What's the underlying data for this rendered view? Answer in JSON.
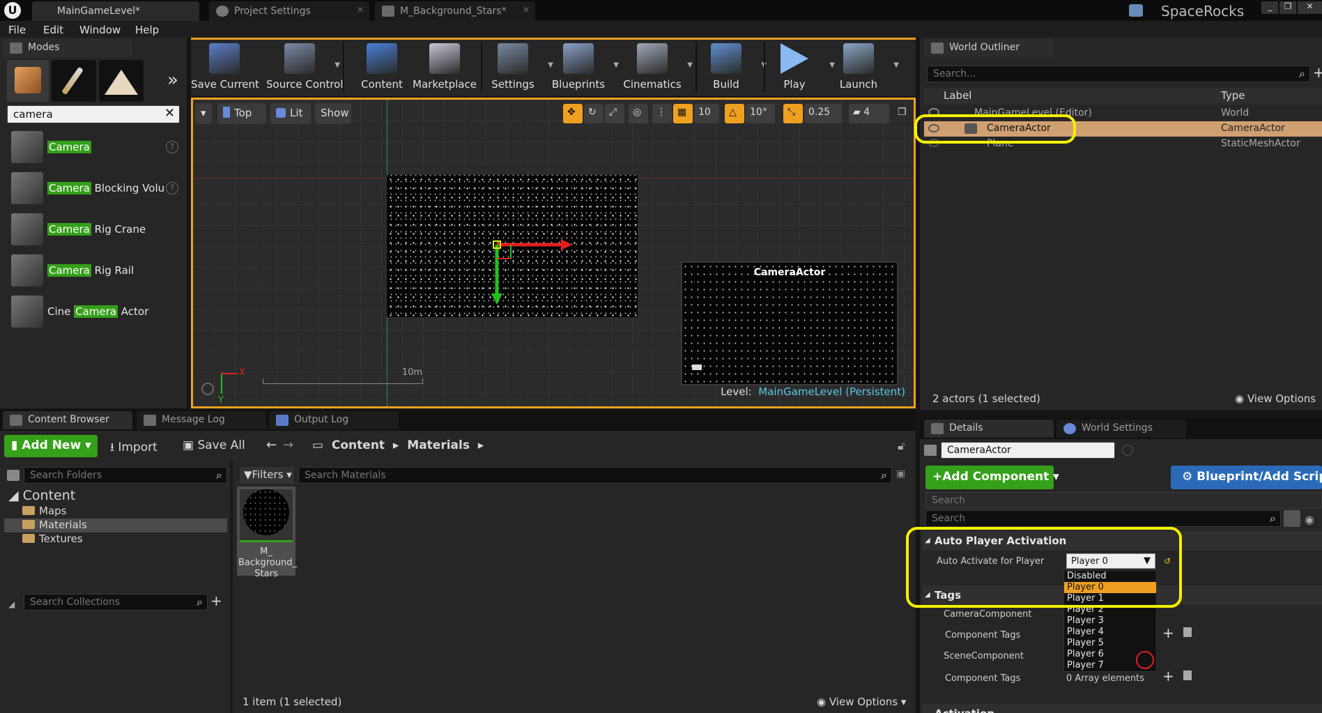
{
  "window": {
    "tabs": [
      "MainGameLevel*",
      "Project Settings",
      "M_Background_Stars*"
    ],
    "project_name": "SpaceRocks"
  },
  "menu": [
    "File",
    "Edit",
    "Window",
    "Help"
  ],
  "modes": {
    "tab_label": "Modes",
    "search_value": "camera",
    "items": [
      {
        "pre": "",
        "hl": "Camera",
        "post": ""
      },
      {
        "pre": "",
        "hl": "Camera",
        "post": " Blocking Volu"
      },
      {
        "pre": "",
        "hl": "Camera",
        "post": " Rig Crane"
      },
      {
        "pre": "",
        "hl": "Camera",
        "post": " Rig Rail"
      },
      {
        "pre": "Cine ",
        "hl": "Camera",
        "post": " Actor"
      }
    ]
  },
  "toolbar": [
    {
      "label": "Save Current",
      "icon": "save-icon",
      "color": "#5a7fc8"
    },
    {
      "label": "Source Control",
      "icon": "source-control-icon",
      "color": "#7a8aa8"
    },
    {
      "label": "Content",
      "icon": "content-icon",
      "color": "#4a80d8"
    },
    {
      "label": "Marketplace",
      "icon": "marketplace-icon",
      "color": "#c8c8d8"
    },
    {
      "label": "Settings",
      "icon": "settings-icon",
      "color": "#7a8aa0"
    },
    {
      "label": "Blueprints",
      "icon": "blueprints-icon",
      "color": "#8aa0c8"
    },
    {
      "label": "Cinematics",
      "icon": "cinematics-icon",
      "color": "#a0a8b8"
    },
    {
      "label": "Build",
      "icon": "build-icon",
      "color": "#6090d0"
    },
    {
      "label": "Play",
      "icon": "play-icon",
      "color": "#8ab8f0"
    },
    {
      "label": "Launch",
      "icon": "launch-icon",
      "color": "#8aa8c8"
    }
  ],
  "viewport": {
    "view_mode": "Top",
    "lit": "Lit",
    "show": "Show",
    "grid_snap": "10",
    "rot_snap": "10°",
    "scale_snap": "0.25",
    "cam_speed": "4",
    "scale_label": "10m",
    "axis_x": "X",
    "axis_y": "Y",
    "preview_title": "CameraActor",
    "level_prefix": "Level:",
    "level_name": "MainGameLevel (Persistent)"
  },
  "outliner": {
    "tab_label": "World Outliner",
    "search_placeholder": "Search...",
    "col_label": "Label",
    "col_type": "Type",
    "rows": [
      {
        "label": "MainGameLevel (Editor)",
        "type": "World"
      },
      {
        "label": "CameraActor",
        "type": "CameraActor"
      },
      {
        "label": "Plane",
        "type": "StaticMeshActor"
      }
    ],
    "status": "2 actors (1 selected)",
    "view_options": "View Options"
  },
  "bottom_tabs": [
    "Content Browser",
    "Message Log",
    "Output Log"
  ],
  "content_browser": {
    "add_new": "Add New",
    "import": "Import",
    "save_all": "Save All",
    "path": [
      "Content",
      "Materials"
    ],
    "search_folders": "Search Folders",
    "filters": "Filters",
    "search_materials": "Search Materials",
    "tree_root": "Content",
    "tree_children": [
      "Maps",
      "Materials",
      "Textures"
    ],
    "search_collections": "Search Collections",
    "asset_name": "M_ Background_ Stars",
    "status": "1 item (1 selected)",
    "view_options": "View Options"
  },
  "details": {
    "tabs": [
      "Details",
      "World Settings"
    ],
    "actor_name": "CameraActor",
    "add_component": "+Add Component",
    "blueprint_btn": "Blueprint/Add Script",
    "search1": "Search",
    "search2": "Search",
    "section_auto": "Auto Player Activation",
    "auto_label": "Auto Activate for Player",
    "auto_value": "Player 0",
    "options": [
      "Disabled",
      "Player 0",
      "Player 1",
      "Player 2",
      "Player 3",
      "Player 4",
      "Player 5",
      "Player 6",
      "Player 7"
    ],
    "selected_option_index": 1,
    "section_tags": "Tags",
    "camera_component": "CameraComponent",
    "component_tags": "Component Tags",
    "scene_component": "SceneComponent",
    "component_tags2": "Component Tags",
    "array_elements": "0 Array elements",
    "section_activation": "Activation"
  },
  "colors": {
    "accent_orange": "#f0a020",
    "highlight_green": "#35a019",
    "annotation_yellow": "#f4f000",
    "blueprint_blue": "#2a6ab8"
  }
}
